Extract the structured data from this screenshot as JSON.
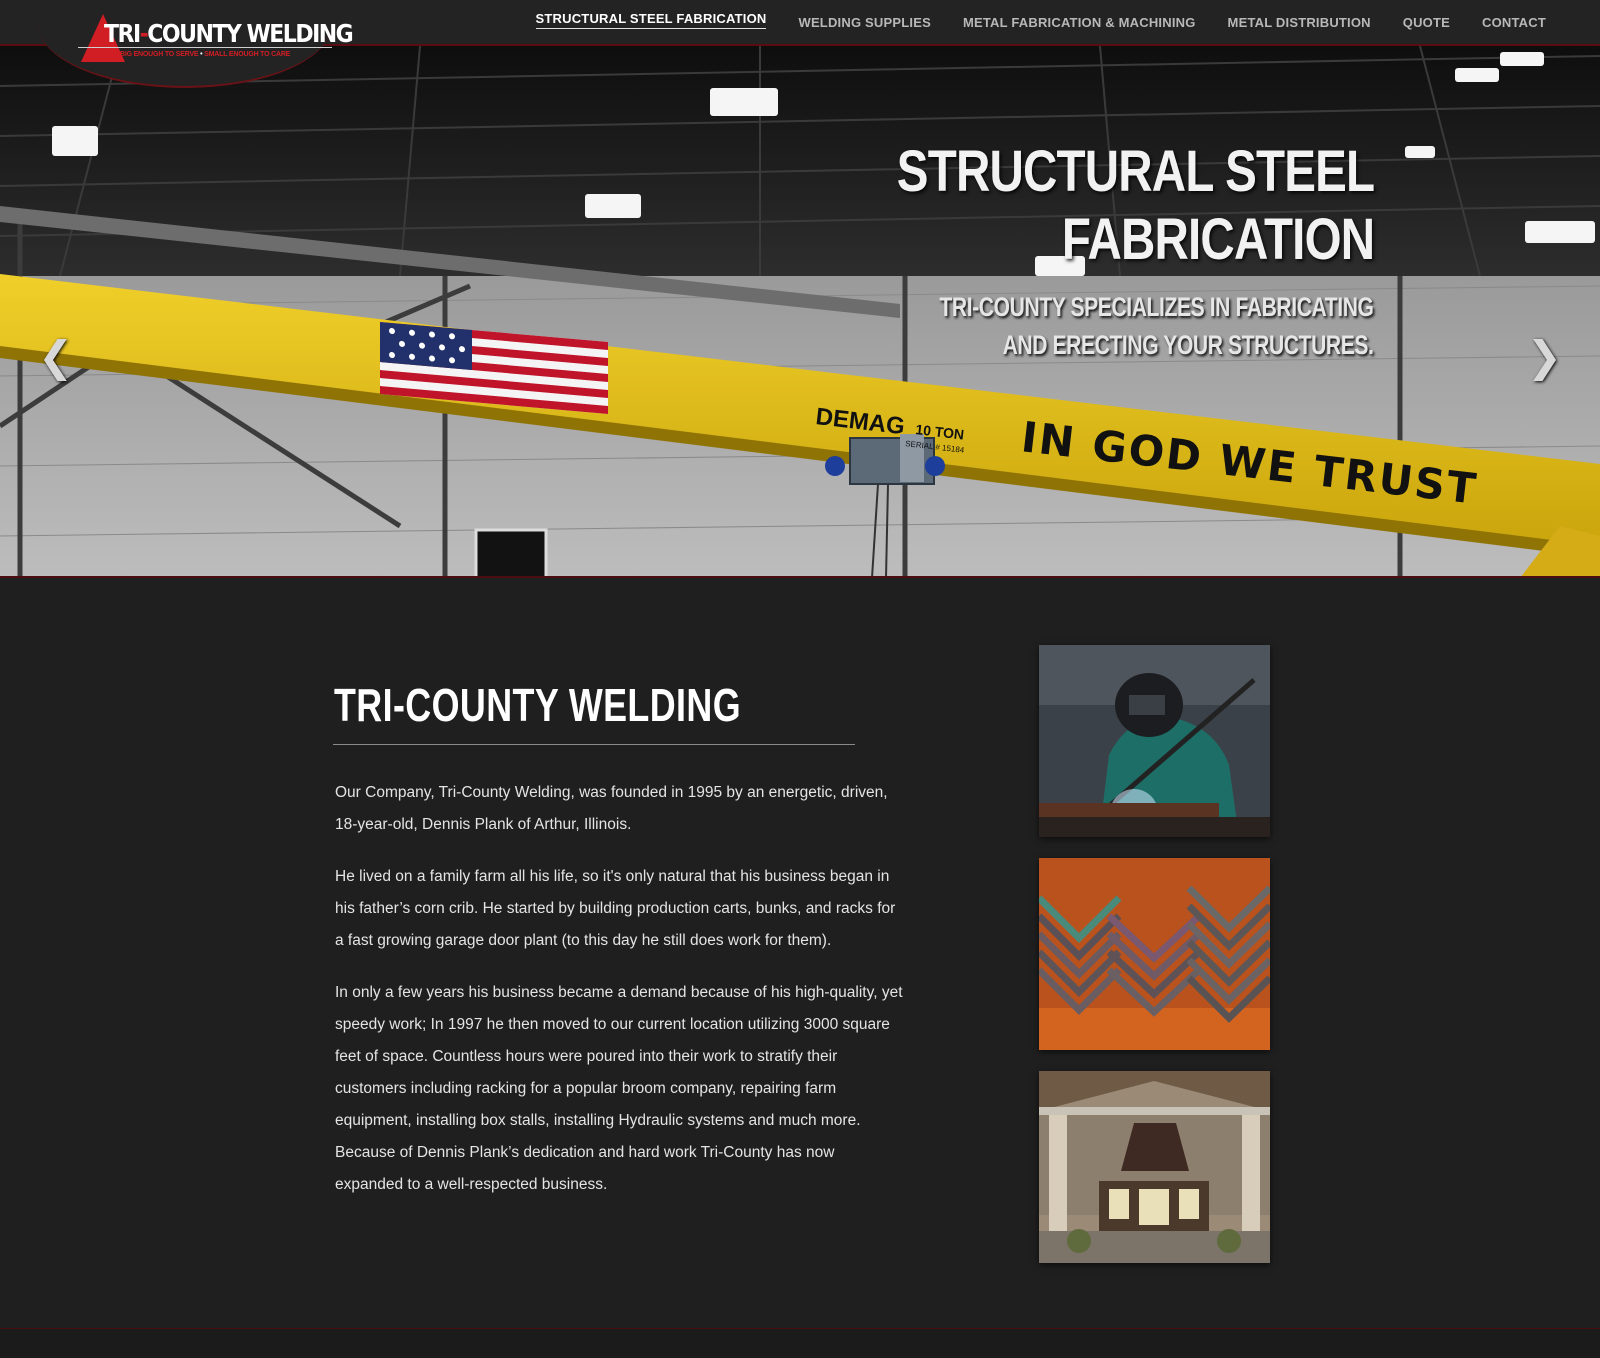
{
  "brand": {
    "name_part1": "TRI",
    "name_part2": "COUNTY WELDING",
    "tagline_left": "BIG ENOUGH TO SERVE",
    "tagline_right": "SMALL ENOUGH TO CARE"
  },
  "nav": {
    "items": [
      {
        "label": "STRUCTURAL STEEL FABRICATION"
      },
      {
        "label": "WELDING SUPPLIES"
      },
      {
        "label": "METAL FABRICATION & MACHINING"
      },
      {
        "label": "METAL DISTRIBUTION"
      },
      {
        "label": "QUOTE"
      },
      {
        "label": "CONTACT"
      }
    ],
    "active_index": 0
  },
  "hero": {
    "title_line1": "STRUCTURAL STEEL",
    "title_line2": "FABRICATION",
    "subtitle_line1": "TRI-COUNTY SPECIALIZES IN FABRICATING",
    "subtitle_line2": "AND ERECTING YOUR STRUCTURES.",
    "prev_icon": "chevron-left-icon",
    "next_icon": "chevron-right-icon",
    "beam_text": "IN GOD WE TRUST",
    "hoist_brand": "DEMAG",
    "hoist_capacity": "10 TON",
    "hoist_serial": "SERIAL # 15184"
  },
  "about": {
    "heading": "TRI-COUNTY WELDING",
    "paragraphs": [
      "Our Company, Tri-County Welding, was founded in 1995 by an energetic, driven, 18-year-old, Dennis Plank of Arthur, Illinois.",
      "He lived on a family farm all his life, so it's only natural that his business began in his father’s corn crib. He started by building production carts, bunks, and racks for a fast growing garage door plant (to this day he still does work for them).",
      "In only a few years his business became a demand because of his high-quality, yet speedy work; In 1997 he then moved to our current location utilizing 3000 square feet of space. Countless hours were poured into their work to stratify their customers including racking for a popular broom company, repairing farm equipment, installing box stalls, installing Hydraulic systems and much more. Because of Dennis Plank’s dedication and hard work Tri-County has now expanded to a well-respected business."
    ]
  },
  "colors": {
    "accent_red": "#d01e24",
    "header_bg": "#232323",
    "content_bg": "#1f1f1f",
    "beam_yellow": "#e5c012"
  }
}
